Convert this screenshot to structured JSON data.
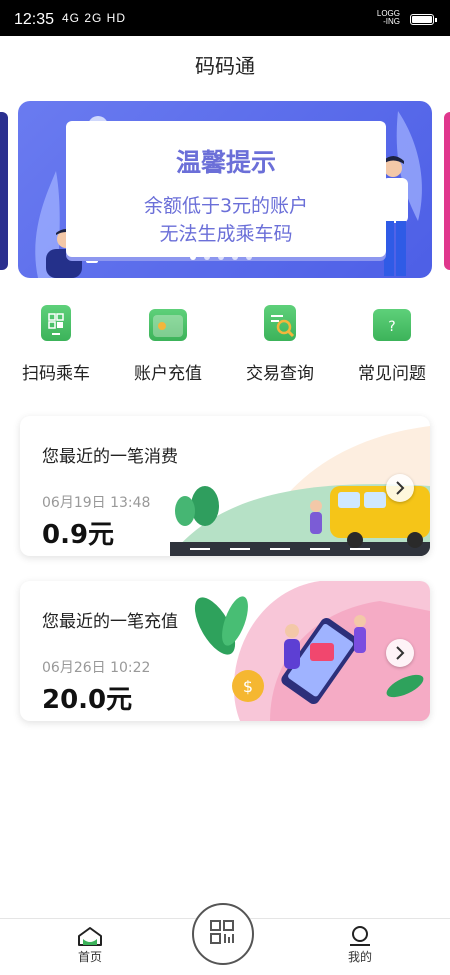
{
  "status_bar": {
    "time": "12:35",
    "signal_text": "4G 2G HD",
    "right_text": "LOGG\n-ING"
  },
  "app": {
    "title": "码码通"
  },
  "banner": {
    "title": "温馨提示",
    "line1": "余额低于3元的账户",
    "line2": "无法生成乘车码"
  },
  "quick_actions": [
    {
      "label": "扫码乘车",
      "icon": "qr-phone-icon"
    },
    {
      "label": "账户充值",
      "icon": "wallet-icon"
    },
    {
      "label": "交易查询",
      "icon": "search-doc-icon"
    },
    {
      "label": "常见问题",
      "icon": "question-folder-icon"
    }
  ],
  "cards": [
    {
      "title": "您最近的一笔消费",
      "date": "06月19日 13:48",
      "amount": "0.9元"
    },
    {
      "title": "您最近的一笔充值",
      "date": "06月26日 10:22",
      "amount": "20.0元"
    }
  ],
  "tabbar": {
    "home": "首页",
    "mine": "我的"
  },
  "colors": {
    "accent_green": "#3cb35a",
    "banner_purple": "#6a7bf0",
    "notice_text": "#6b6fd8"
  }
}
